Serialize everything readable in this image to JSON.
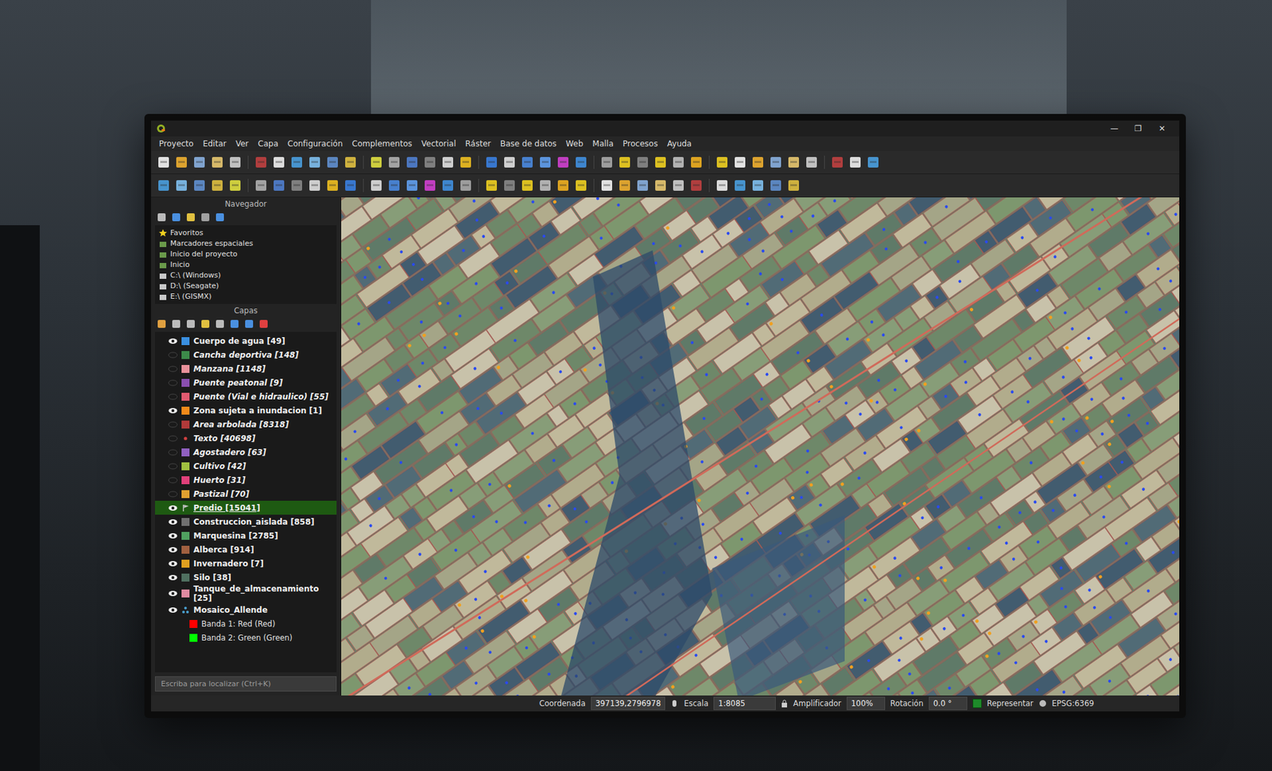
{
  "window": {
    "controls": [
      "—",
      "❐",
      "✕"
    ]
  },
  "menus": [
    "Proyecto",
    "Editar",
    "Ver",
    "Capa",
    "Configuración",
    "Complementos",
    "Vectorial",
    "Ráster",
    "Base de datos",
    "Web",
    "Malla",
    "Procesos",
    "Ayuda"
  ],
  "navigator": {
    "title": "Navegador",
    "items": [
      "Favoritos",
      "Marcadores espaciales",
      "Inicio del proyecto",
      "Inicio",
      "C:\\ (Windows)",
      "D:\\ (Seagate)",
      "E:\\ (GISMX)"
    ]
  },
  "layers": {
    "title": "Capas",
    "items": [
      {
        "label": "Cuerpo de agua [49]",
        "visible": true,
        "in_scale": true,
        "selected": false,
        "color": "#3a8fe0",
        "kind": "fill"
      },
      {
        "label": "Cancha deportiva [148]",
        "visible": false,
        "in_scale": false,
        "selected": false,
        "color": "#3d8a4a",
        "kind": "fill"
      },
      {
        "label": "Manzana [1148]",
        "visible": false,
        "in_scale": false,
        "selected": false,
        "color": "#e8919a",
        "kind": "fill"
      },
      {
        "label": "Puente peatonal [9]",
        "visible": false,
        "in_scale": false,
        "selected": false,
        "color": "#8a4fb0",
        "kind": "fill"
      },
      {
        "label": "Puente (Vial e hidraulico) [55]",
        "visible": false,
        "in_scale": false,
        "selected": false,
        "color": "#e05a70",
        "kind": "fill"
      },
      {
        "label": "Zona sujeta a inundacion [1]",
        "visible": true,
        "in_scale": true,
        "selected": false,
        "color": "#f08a1a",
        "kind": "fill"
      },
      {
        "label": "Area arbolada [8318]",
        "visible": false,
        "in_scale": false,
        "selected": false,
        "color": "#b03a3a",
        "kind": "fill"
      },
      {
        "label": "Texto [40698]",
        "visible": false,
        "in_scale": false,
        "selected": false,
        "color": "#d04040",
        "kind": "point"
      },
      {
        "label": "Agostadero [63]",
        "visible": false,
        "in_scale": false,
        "selected": false,
        "color": "#9060c0",
        "kind": "fill"
      },
      {
        "label": "Cultivo [42]",
        "visible": false,
        "in_scale": false,
        "selected": false,
        "color": "#a0c040",
        "kind": "fill"
      },
      {
        "label": "Huerto [31]",
        "visible": false,
        "in_scale": false,
        "selected": false,
        "color": "#e0407a",
        "kind": "fill"
      },
      {
        "label": "Pastizal [70]",
        "visible": false,
        "in_scale": false,
        "selected": false,
        "color": "#e0a030",
        "kind": "fill"
      },
      {
        "label": "Predio [15041]",
        "visible": true,
        "in_scale": true,
        "selected": true,
        "color": "#c0c0c0",
        "kind": "rule"
      },
      {
        "label": "Construccion_aislada [858]",
        "visible": true,
        "in_scale": true,
        "selected": false,
        "color": "#707070",
        "kind": "fill"
      },
      {
        "label": "Marquesina [2785]",
        "visible": true,
        "in_scale": true,
        "selected": false,
        "color": "#50a060",
        "kind": "fill"
      },
      {
        "label": "Alberca [914]",
        "visible": true,
        "in_scale": true,
        "selected": false,
        "color": "#a06040",
        "kind": "fill"
      },
      {
        "label": "Invernadero [7]",
        "visible": true,
        "in_scale": true,
        "selected": false,
        "color": "#e0a020",
        "kind": "fill"
      },
      {
        "label": "Silo [38]",
        "visible": true,
        "in_scale": true,
        "selected": false,
        "color": "#507060",
        "kind": "fill"
      },
      {
        "label": "Tanque_de_almacenamiento [25]",
        "visible": true,
        "in_scale": true,
        "selected": false,
        "color": "#e08aa0",
        "kind": "fill"
      },
      {
        "label": "Mosaico_Allende",
        "visible": true,
        "in_scale": true,
        "selected": false,
        "color": "#4aa0d0",
        "kind": "raster",
        "expanded": true
      }
    ],
    "bands": [
      {
        "label": "Banda 1: Red (Red)",
        "color": "#ff0000"
      },
      {
        "label": "Banda 2: Green (Green)",
        "color": "#00ff00"
      }
    ]
  },
  "search": {
    "placeholder": "Escriba para localizar (Ctrl+K)"
  },
  "status_bar": {
    "coord_label": "Coordenada",
    "coord": "397139,2796978",
    "scale_label": "Escala",
    "scale": "1:8085",
    "magnifier_label": "Amplificador",
    "magnifier": "100%",
    "rotation_label": "Rotación",
    "rotation": "0.0 °",
    "render_label": "Representar",
    "render": true,
    "crs": "EPSG:6369"
  }
}
